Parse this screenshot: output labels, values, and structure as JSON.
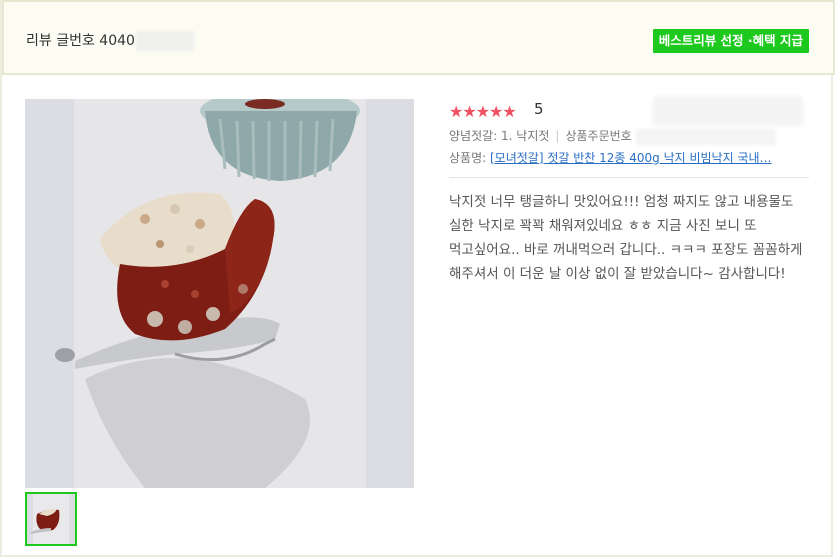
{
  "header": {
    "review_number_label": "리뷰 글번호 4040",
    "best_badge": "베스트리뷰 선정 ·혜택 지급"
  },
  "review": {
    "stars": "★★★★★",
    "rating": "5",
    "option_label": "양념젓갈: 1. 낙지젓",
    "order_label": "상품주문번호",
    "product_prefix": "상품명:",
    "product_name": "[모녀젓갈] 젓갈 반찬 12종 400g 낙지 비빔낙지 국내…",
    "text": "낙지젓 너무 탱글하니 맛있어요!!! 엄청 짜지도 않고 내용물도 실한 낙지로 꽉꽉 채워져있네요 ㅎㅎ 지금 사진 보니 또 먹고싶어요.. 바로 꺼내먹으러 갑니다.. ㅋㅋㅋ 포장도 꼼꼼하게 해주셔서 이 더운 날 이상 없이 잘 받았습니다~ 감사합니다!"
  },
  "colors": {
    "badge": "#1ec91e",
    "star": "#f25163",
    "link": "#2a6ec4"
  }
}
